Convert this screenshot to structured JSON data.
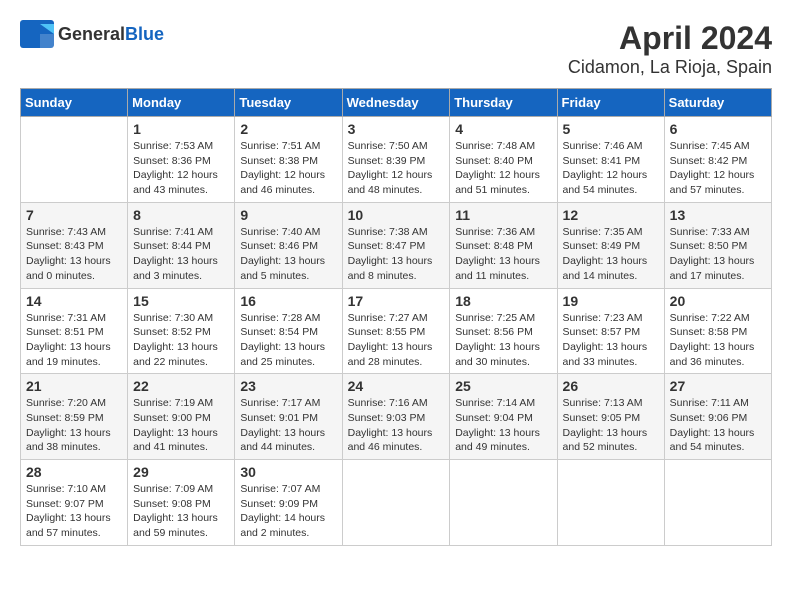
{
  "header": {
    "logo_general": "General",
    "logo_blue": "Blue",
    "title": "April 2024",
    "subtitle": "Cidamon, La Rioja, Spain"
  },
  "columns": [
    "Sunday",
    "Monday",
    "Tuesday",
    "Wednesday",
    "Thursday",
    "Friday",
    "Saturday"
  ],
  "weeks": [
    [
      {
        "day": "",
        "info": ""
      },
      {
        "day": "1",
        "info": "Sunrise: 7:53 AM\nSunset: 8:36 PM\nDaylight: 12 hours\nand 43 minutes."
      },
      {
        "day": "2",
        "info": "Sunrise: 7:51 AM\nSunset: 8:38 PM\nDaylight: 12 hours\nand 46 minutes."
      },
      {
        "day": "3",
        "info": "Sunrise: 7:50 AM\nSunset: 8:39 PM\nDaylight: 12 hours\nand 48 minutes."
      },
      {
        "day": "4",
        "info": "Sunrise: 7:48 AM\nSunset: 8:40 PM\nDaylight: 12 hours\nand 51 minutes."
      },
      {
        "day": "5",
        "info": "Sunrise: 7:46 AM\nSunset: 8:41 PM\nDaylight: 12 hours\nand 54 minutes."
      },
      {
        "day": "6",
        "info": "Sunrise: 7:45 AM\nSunset: 8:42 PM\nDaylight: 12 hours\nand 57 minutes."
      }
    ],
    [
      {
        "day": "7",
        "info": "Sunrise: 7:43 AM\nSunset: 8:43 PM\nDaylight: 13 hours\nand 0 minutes."
      },
      {
        "day": "8",
        "info": "Sunrise: 7:41 AM\nSunset: 8:44 PM\nDaylight: 13 hours\nand 3 minutes."
      },
      {
        "day": "9",
        "info": "Sunrise: 7:40 AM\nSunset: 8:46 PM\nDaylight: 13 hours\nand 5 minutes."
      },
      {
        "day": "10",
        "info": "Sunrise: 7:38 AM\nSunset: 8:47 PM\nDaylight: 13 hours\nand 8 minutes."
      },
      {
        "day": "11",
        "info": "Sunrise: 7:36 AM\nSunset: 8:48 PM\nDaylight: 13 hours\nand 11 minutes."
      },
      {
        "day": "12",
        "info": "Sunrise: 7:35 AM\nSunset: 8:49 PM\nDaylight: 13 hours\nand 14 minutes."
      },
      {
        "day": "13",
        "info": "Sunrise: 7:33 AM\nSunset: 8:50 PM\nDaylight: 13 hours\nand 17 minutes."
      }
    ],
    [
      {
        "day": "14",
        "info": "Sunrise: 7:31 AM\nSunset: 8:51 PM\nDaylight: 13 hours\nand 19 minutes."
      },
      {
        "day": "15",
        "info": "Sunrise: 7:30 AM\nSunset: 8:52 PM\nDaylight: 13 hours\nand 22 minutes."
      },
      {
        "day": "16",
        "info": "Sunrise: 7:28 AM\nSunset: 8:54 PM\nDaylight: 13 hours\nand 25 minutes."
      },
      {
        "day": "17",
        "info": "Sunrise: 7:27 AM\nSunset: 8:55 PM\nDaylight: 13 hours\nand 28 minutes."
      },
      {
        "day": "18",
        "info": "Sunrise: 7:25 AM\nSunset: 8:56 PM\nDaylight: 13 hours\nand 30 minutes."
      },
      {
        "day": "19",
        "info": "Sunrise: 7:23 AM\nSunset: 8:57 PM\nDaylight: 13 hours\nand 33 minutes."
      },
      {
        "day": "20",
        "info": "Sunrise: 7:22 AM\nSunset: 8:58 PM\nDaylight: 13 hours\nand 36 minutes."
      }
    ],
    [
      {
        "day": "21",
        "info": "Sunrise: 7:20 AM\nSunset: 8:59 PM\nDaylight: 13 hours\nand 38 minutes."
      },
      {
        "day": "22",
        "info": "Sunrise: 7:19 AM\nSunset: 9:00 PM\nDaylight: 13 hours\nand 41 minutes."
      },
      {
        "day": "23",
        "info": "Sunrise: 7:17 AM\nSunset: 9:01 PM\nDaylight: 13 hours\nand 44 minutes."
      },
      {
        "day": "24",
        "info": "Sunrise: 7:16 AM\nSunset: 9:03 PM\nDaylight: 13 hours\nand 46 minutes."
      },
      {
        "day": "25",
        "info": "Sunrise: 7:14 AM\nSunset: 9:04 PM\nDaylight: 13 hours\nand 49 minutes."
      },
      {
        "day": "26",
        "info": "Sunrise: 7:13 AM\nSunset: 9:05 PM\nDaylight: 13 hours\nand 52 minutes."
      },
      {
        "day": "27",
        "info": "Sunrise: 7:11 AM\nSunset: 9:06 PM\nDaylight: 13 hours\nand 54 minutes."
      }
    ],
    [
      {
        "day": "28",
        "info": "Sunrise: 7:10 AM\nSunset: 9:07 PM\nDaylight: 13 hours\nand 57 minutes."
      },
      {
        "day": "29",
        "info": "Sunrise: 7:09 AM\nSunset: 9:08 PM\nDaylight: 13 hours\nand 59 minutes."
      },
      {
        "day": "30",
        "info": "Sunrise: 7:07 AM\nSunset: 9:09 PM\nDaylight: 14 hours\nand 2 minutes."
      },
      {
        "day": "",
        "info": ""
      },
      {
        "day": "",
        "info": ""
      },
      {
        "day": "",
        "info": ""
      },
      {
        "day": "",
        "info": ""
      }
    ]
  ]
}
